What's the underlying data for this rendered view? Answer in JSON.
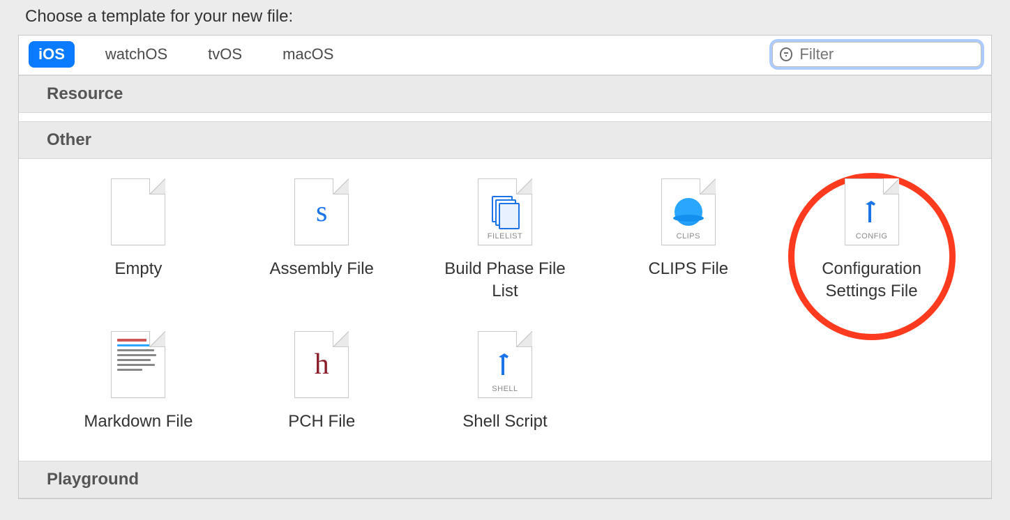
{
  "title": "Choose a template for your new file:",
  "tabs": {
    "ios": "iOS",
    "watchos": "watchOS",
    "tvos": "tvOS",
    "macos": "macOS"
  },
  "filter": {
    "placeholder": "Filter"
  },
  "sections": {
    "resource": "Resource",
    "other": "Other",
    "playground": "Playground"
  },
  "templates": {
    "empty": {
      "label": "Empty"
    },
    "assembly": {
      "label": "Assembly File",
      "glyph": "s"
    },
    "buildphase": {
      "label": "Build Phase File List",
      "caption": "FILELIST"
    },
    "clips": {
      "label": "CLIPS File",
      "caption": "CLIPS"
    },
    "config": {
      "label": "Configuration Settings File",
      "caption": "CONFIG"
    },
    "markdown": {
      "label": "Markdown File"
    },
    "pch": {
      "label": "PCH File",
      "glyph": "h"
    },
    "shell": {
      "label": "Shell Script",
      "caption": "SHELL"
    }
  },
  "annotation": {
    "highlighted": "config"
  }
}
